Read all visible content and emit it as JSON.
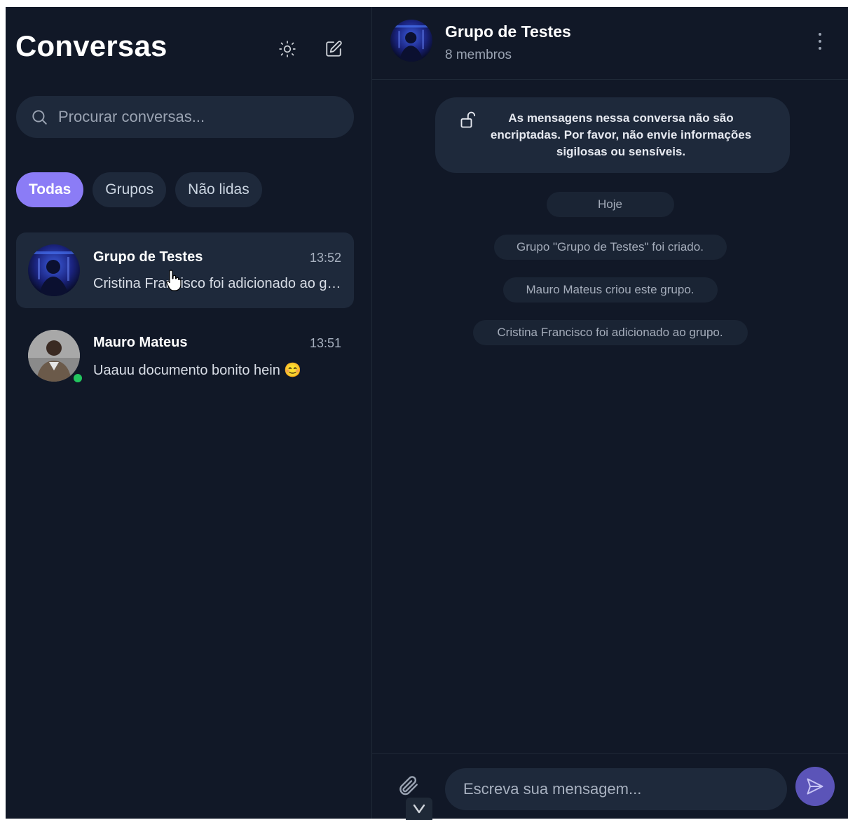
{
  "sidebar": {
    "title": "Conversas",
    "search_placeholder": "Procurar conversas...",
    "filters": [
      "Todas",
      "Grupos",
      "Não lidas"
    ],
    "conversations": [
      {
        "name": "Grupo de Testes",
        "time": "13:52",
        "preview": "Cristina Francisco foi adicionado ao grupo.",
        "active": true
      },
      {
        "name": "Mauro Mateus",
        "time": "13:51",
        "preview": "Uaauu documento bonito hein 😊",
        "online": true
      }
    ]
  },
  "chat": {
    "title": "Grupo de Testes",
    "subtitle": "8 membros",
    "notice": "As mensagens nessa conversa não são encriptadas. Por favor, não envie informações sigilosas ou sensíveis.",
    "date_label": "Hoje",
    "system_messages": [
      "Grupo \"Grupo de Testes\" foi criado.",
      "Mauro Mateus criou este grupo.",
      "Cristina Francisco foi adicionado ao grupo."
    ],
    "input_placeholder": "Escreva sua mensagem..."
  },
  "colors": {
    "background": "#111827",
    "surface": "#1e293b",
    "accent": "#8b7cf6",
    "send": "#5b54b8",
    "online": "#22c55e"
  },
  "icons": [
    "sun-icon",
    "edit-icon",
    "search-icon",
    "more-vertical-icon",
    "unlock-icon",
    "paperclip-icon",
    "send-icon",
    "chevron-down-icon"
  ]
}
